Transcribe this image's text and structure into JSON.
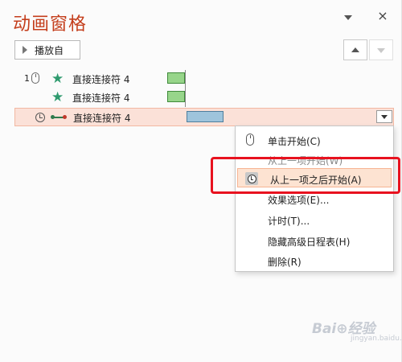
{
  "pane": {
    "title": "动画窗格",
    "close_glyph": "×",
    "play_label": "播放自"
  },
  "rows": [
    {
      "num": "1",
      "name": "直接连接符 4"
    },
    {
      "num": "",
      "name": "直接连接符 4"
    },
    {
      "num": "",
      "name": "直接连接符 4"
    }
  ],
  "menu": {
    "items": [
      {
        "label": "单击开始(C)"
      },
      {
        "label": "从上一项开始(W)"
      },
      {
        "label": "从上一项之后开始(A)"
      },
      {
        "label": "效果选项(E)..."
      },
      {
        "label": "计时(T)..."
      },
      {
        "label": "隐藏高级日程表(H)"
      },
      {
        "label": "删除(R)"
      }
    ]
  },
  "watermark": {
    "text": "Bai⊕经验",
    "sub": "jingyan.baidu.com"
  },
  "colors": {
    "title": "#c43e1c",
    "selected_row": "#fbe1d8",
    "highlight_box": "#e8121f",
    "star": "#2f9b6f"
  }
}
